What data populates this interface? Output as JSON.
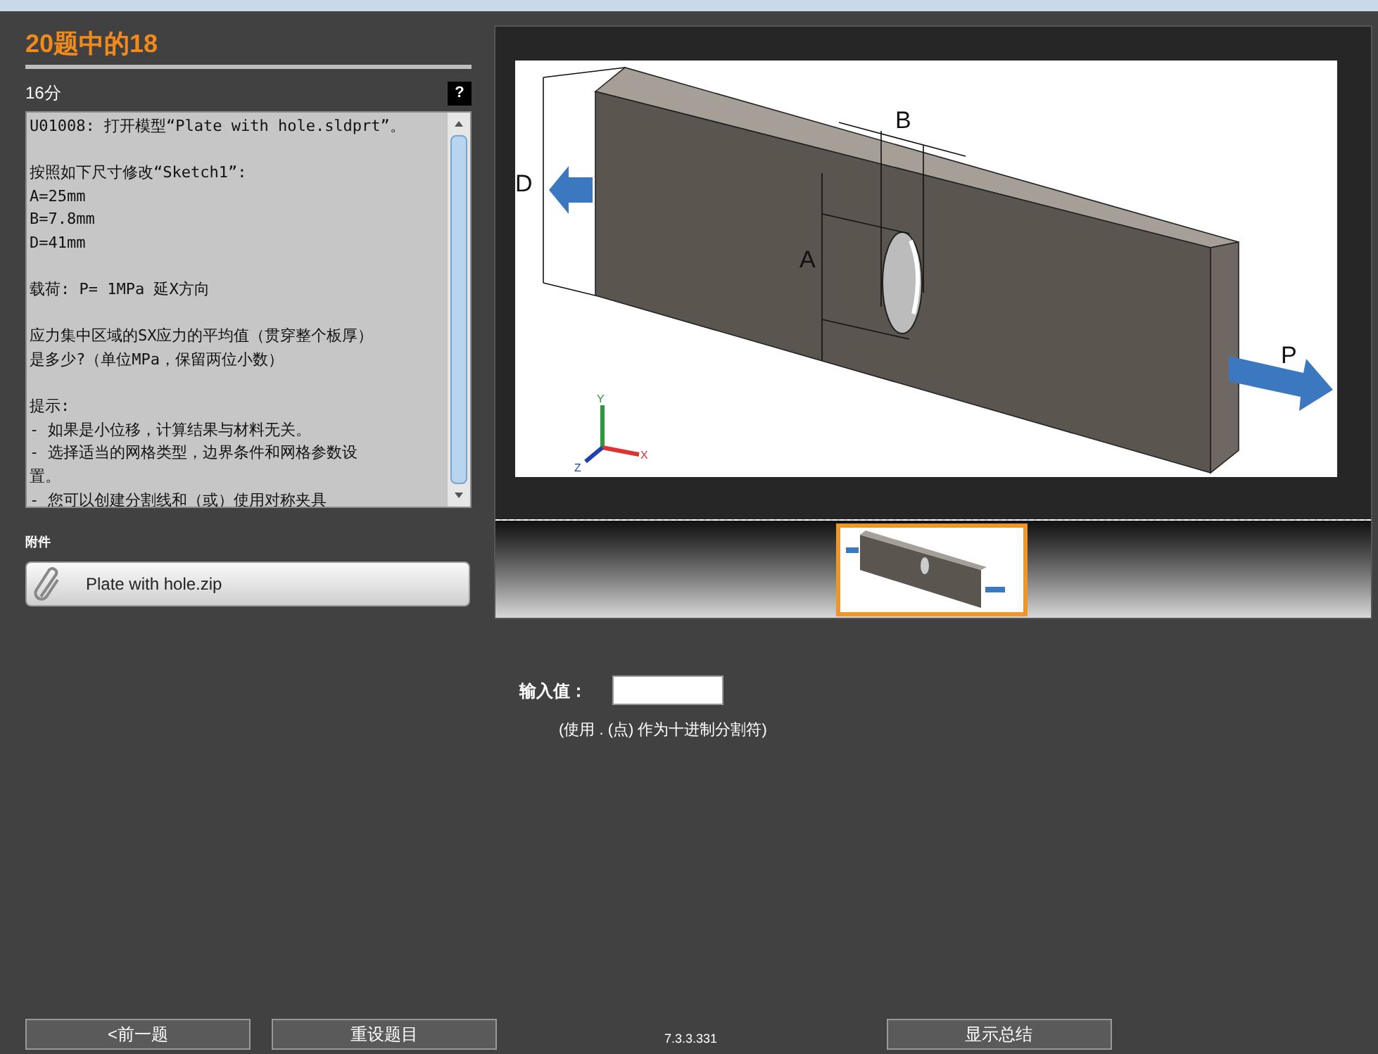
{
  "header": {
    "title": "20题中的18",
    "score": "16分",
    "help_button": "?"
  },
  "question": {
    "paragraphs": [
      [
        "U01008: 打开模型“Plate with hole.sldprt”。"
      ],
      [
        "按照如下尺寸修改“Sketch1”:",
        "A=25mm",
        "B=7.8mm",
        "D=41mm"
      ],
      [
        "载荷: P= 1MPa 延X方向"
      ],
      [
        "应力集中区域的SX应力的平均值（贯穿整个板厚）",
        "是多少?（单位MPa，保留两位小数）"
      ],
      [
        "提示:",
        "- 如果是小位移，计算结果与材料无关。",
        "- 选择适当的网格类型，边界条件和网格参数设",
        "置。",
        "- 您可以创建分割线和（或）使用对称夹具"
      ]
    ]
  },
  "attachments": {
    "label": "附件",
    "files": [
      {
        "name": "Plate with hole.zip"
      }
    ]
  },
  "figure": {
    "labels": {
      "dim_a": "A",
      "dim_b": "B",
      "dim_d": "D",
      "load": "P",
      "axis_x": "X",
      "axis_y": "Y",
      "axis_z": "Z"
    }
  },
  "thumbnails": [
    {
      "selected": true
    }
  ],
  "answer": {
    "label": "输入值：",
    "hint": "(使用 . (点) 作为十进制分割符)"
  },
  "footer": {
    "buttons": [
      {
        "label": "<前一题"
      },
      {
        "label": "重设题目"
      },
      {
        "label": "显示总结"
      }
    ],
    "version": "7.3.3.331"
  }
}
